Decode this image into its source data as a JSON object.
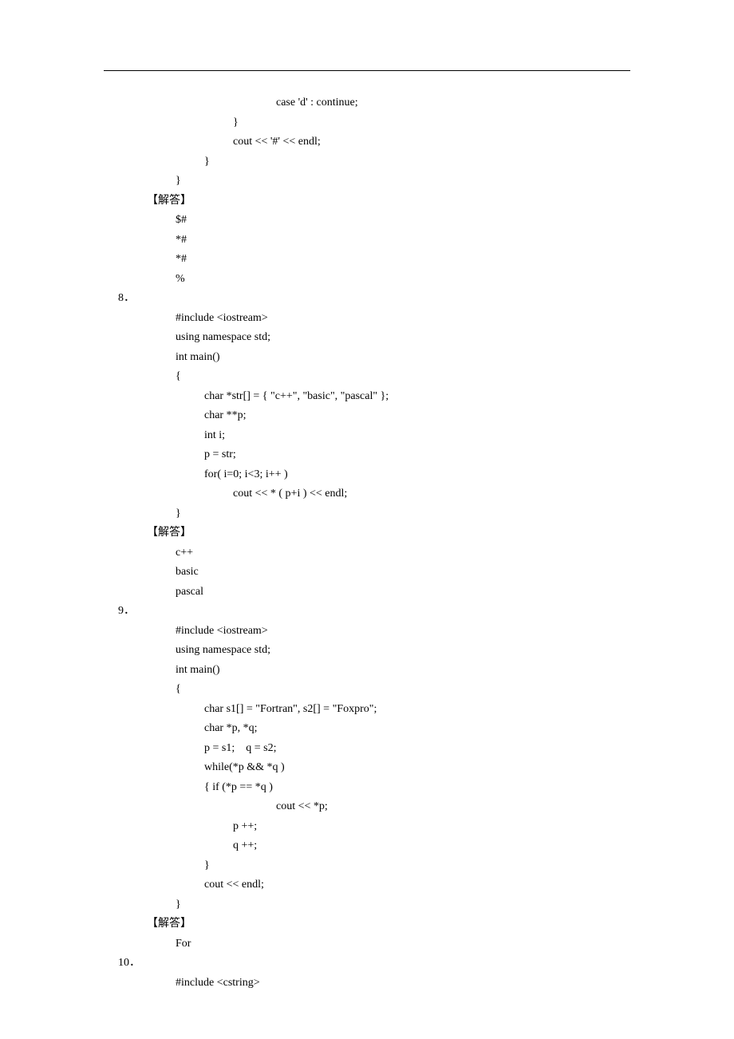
{
  "block1": {
    "l1": "case 'd' : continue;",
    "l2": "}",
    "l3": "cout << '#' << endl;",
    "l4": "}",
    "l5": "}"
  },
  "answer_label": "【解答】",
  "block1_answer": {
    "l1": "$#",
    "l2": "*#",
    "l3": "*#",
    "l4": "%"
  },
  "q8_label": "8．",
  "block2": {
    "l1": "#include <iostream>",
    "l2": "using namespace std;",
    "l3": "int main()",
    "l4": "{",
    "l5": "char *str[] = { \"c++\", \"basic\", \"pascal\" };",
    "l6": "char **p;",
    "l7": "int i;",
    "l8": "p = str;",
    "l9": "for( i=0; i<3; i++ )",
    "l10": "cout << * ( p+i ) << endl;",
    "l11": "}"
  },
  "block2_answer": {
    "l1": "c++",
    "l2": "basic",
    "l3": "pascal"
  },
  "q9_label": "9．",
  "block3": {
    "l1": "#include <iostream>",
    "l2": "using namespace std;",
    "l3": "int main()",
    "l4": "{",
    "l5": "char s1[] = \"Fortran\", s2[] = \"Foxpro\";",
    "l6": "char *p, *q;",
    "l7": "p = s1;    q = s2;",
    "l8": "while(*p && *q )",
    "l9": "{ if (*p == *q )",
    "l10": "cout << *p;",
    "l11": "p ++;",
    "l12": "q ++;",
    "l13": "}",
    "l14": "cout << endl;",
    "l15": "}"
  },
  "block3_answer": {
    "l1": "For"
  },
  "q10_label": "10．",
  "block4": {
    "l1": "#include <cstring>"
  }
}
